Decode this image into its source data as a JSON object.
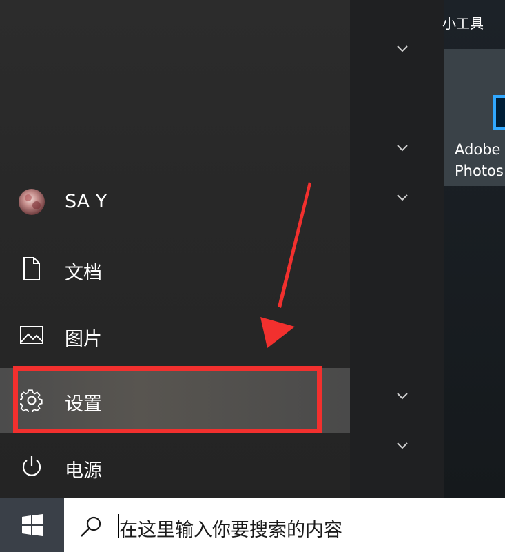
{
  "tiles": {
    "group_title": "小工具",
    "photoshop_label": "Adobe\nPhotos"
  },
  "nav": {
    "user": {
      "label": "SA Y",
      "icon": "avatar"
    },
    "documents": {
      "label": "文档",
      "icon": "document-icon"
    },
    "pictures": {
      "label": "图片",
      "icon": "picture-icon"
    },
    "settings": {
      "label": "设置",
      "icon": "gear-icon"
    },
    "power": {
      "label": "电源",
      "icon": "power-icon"
    }
  },
  "taskbar": {
    "start_icon": "windows-logo-icon",
    "search_placeholder": "在这里输入你要搜索的内容",
    "search_icon": "search-icon"
  },
  "colors": {
    "highlight_annotation": "#f2302e",
    "photoshop_blue": "#31a8ff"
  }
}
